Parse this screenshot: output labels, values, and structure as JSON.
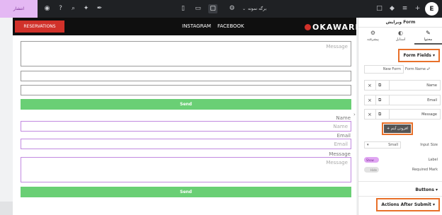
{
  "toolbar": {
    "publish_label": "انتشار",
    "page_name": "برگه نمونه",
    "logo_glyph": "E"
  },
  "site": {
    "reservations_label": "RESERVATIONS",
    "nav": [
      "INSTAGRAM",
      "FACEBOOK"
    ],
    "brand": "OKAWARI"
  },
  "form_top": {
    "message_placeholder": "Message",
    "send_label": "Send"
  },
  "form_bottom": {
    "name_label": "Name",
    "name_placeholder": "Name",
    "email_label": "Email",
    "email_placeholder": "Email",
    "message_label": "Message",
    "message_placeholder": "Message",
    "send_label": "Send"
  },
  "panel": {
    "title": "ویرایش Form",
    "tabs": [
      {
        "label": "محتوا",
        "icon": "pencil-icon"
      },
      {
        "label": "استایل",
        "icon": "contrast-icon"
      },
      {
        "label": "پیشرفته",
        "icon": "gear-icon"
      }
    ],
    "form_fields_heading": "Form Fields",
    "form_name_label": "Form Name",
    "form_name_value": "New Form",
    "fields": [
      "Name",
      "Email",
      "Message"
    ],
    "add_item_label": "افزودن آیتم",
    "input_size_label": "Input Size",
    "input_size_value": "Small",
    "label_label": "Label",
    "label_toggle": "Show",
    "required_mark_label": "Required Mark",
    "required_toggle": "Hide",
    "buttons_heading": "Buttons",
    "actions_heading": "Actions After Submit"
  },
  "colors": {
    "toolbar_bg": "#1f2124",
    "publish_bg": "#e4b8f3",
    "send_green": "#6acf75",
    "reservations_red": "#d1312a",
    "highlight_orange": "#e8702a"
  }
}
